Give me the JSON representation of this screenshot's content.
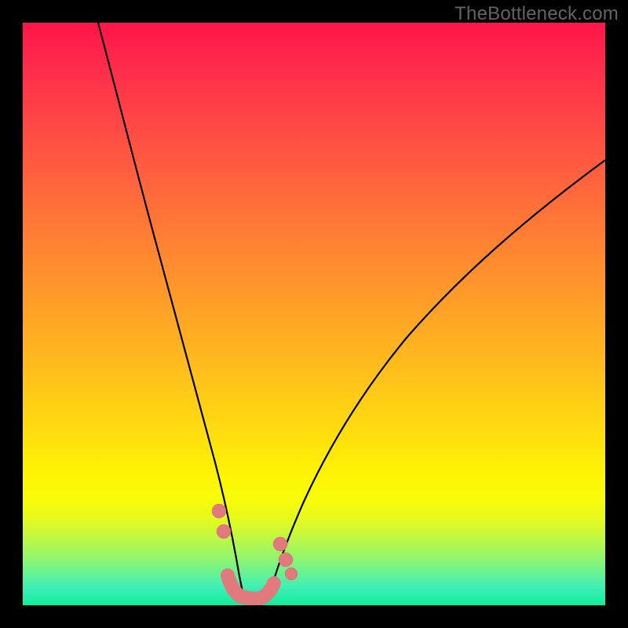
{
  "watermark_text": "TheBottleneck.com",
  "chart_data": {
    "type": "line",
    "title": "",
    "xlabel": "",
    "ylabel": "",
    "xlim": [
      0,
      100
    ],
    "ylim": [
      0,
      100
    ],
    "grid": false,
    "legend": false,
    "series": [
      {
        "name": "left-curve",
        "x": [
          13,
          15,
          18,
          21,
          24,
          27,
          29,
          31,
          33,
          34.5,
          36,
          37
        ],
        "y": [
          100,
          90,
          78,
          66,
          54,
          40,
          30,
          22,
          14,
          9,
          5,
          2
        ]
      },
      {
        "name": "right-curve",
        "x": [
          42,
          44,
          47,
          51,
          56,
          62,
          70,
          80,
          92,
          100
        ],
        "y": [
          2,
          6,
          12,
          20,
          30,
          40,
          52,
          62,
          72,
          78
        ]
      }
    ],
    "markers": [
      {
        "x": 33.5,
        "y": 16
      },
      {
        "x": 34.5,
        "y": 12
      },
      {
        "x": 44.0,
        "y": 10
      },
      {
        "x": 45.0,
        "y": 7
      },
      {
        "x": 46.0,
        "y": 5
      }
    ],
    "bottom_segment": {
      "x": [
        35,
        36,
        37,
        38,
        39,
        40,
        41,
        42,
        43
      ],
      "y": [
        5,
        2.5,
        1.5,
        1.2,
        1.2,
        1.2,
        1.5,
        2.5,
        4
      ]
    },
    "gradient_stops": [
      {
        "pos": 0,
        "color": "#ff154a"
      },
      {
        "pos": 50,
        "color": "#ff9e28"
      },
      {
        "pos": 78,
        "color": "#fef603"
      },
      {
        "pos": 100,
        "color": "#0eed9a"
      }
    ]
  }
}
